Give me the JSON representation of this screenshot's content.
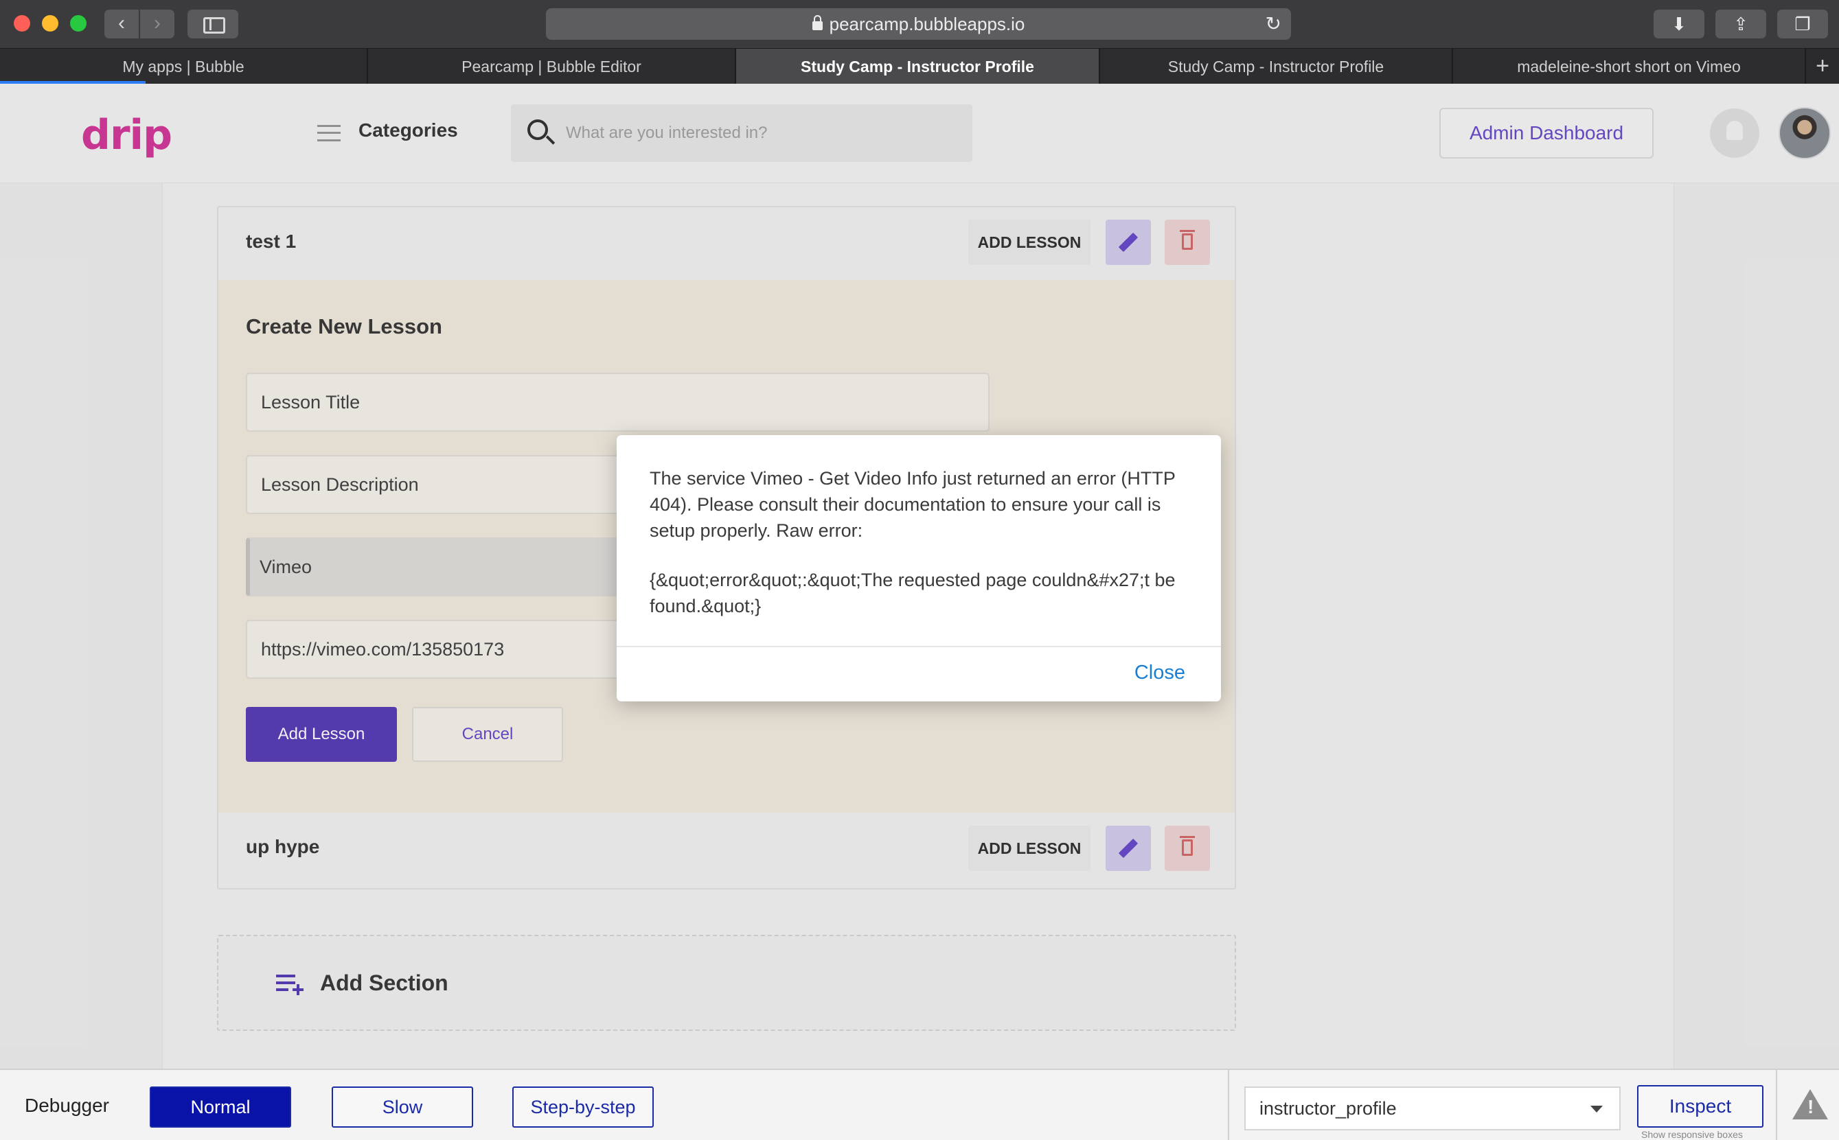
{
  "browser": {
    "url": "pearcamp.bubbleapps.io",
    "tabs": [
      {
        "label": "My apps | Bubble",
        "active": false
      },
      {
        "label": "Pearcamp | Bubble Editor",
        "active": false
      },
      {
        "label": "Study Camp - Instructor Profile",
        "active": true
      },
      {
        "label": "Study Camp - Instructor Profile",
        "active": false
      },
      {
        "label": "madeleine-short short on Vimeo",
        "active": false
      }
    ],
    "icons": [
      "back-icon",
      "forward-icon",
      "sidebar-icon",
      "lock-icon",
      "reload-icon",
      "download-icon",
      "share-icon",
      "tabs-overview-icon",
      "new-tab-icon"
    ]
  },
  "header": {
    "logo": "drip",
    "categories_label": "Categories",
    "search_placeholder": "What are you interested in?",
    "admin_button": "Admin Dashboard"
  },
  "sections": [
    {
      "title": "test 1",
      "add_lesson_label": "ADD LESSON"
    },
    {
      "title": "up hype",
      "add_lesson_label": "ADD LESSON"
    }
  ],
  "lesson_form": {
    "title": "Create New Lesson",
    "lesson_title_placeholder": "Lesson Title",
    "lesson_description_placeholder": "Lesson Description",
    "provider_value": "Vimeo",
    "video_url_value": "https://vimeo.com/135850173",
    "add_button": "Add Lesson",
    "cancel_button": "Cancel"
  },
  "add_section_label": "Add Section",
  "modal": {
    "message": "The service Vimeo - Get Video Info just returned an error (HTTP 404). Please consult their documentation to ensure your call is setup properly. Raw error:",
    "raw_error": "{&quot;error&quot;:&quot;The requested page couldn&#x27;t be found.&quot;}",
    "close_label": "Close"
  },
  "debugger": {
    "label": "Debugger",
    "modes": [
      "Normal",
      "Slow",
      "Step-by-step"
    ],
    "active_mode": "Normal",
    "page_select_value": "instructor_profile",
    "inspect_label": "Inspect",
    "responsive_note": "Show responsive boxes"
  },
  "colors": {
    "brand": "#d43b9c",
    "accent": "#5a3fb8",
    "link": "#1a7fd4",
    "debugger_active": "#0a13a8"
  }
}
